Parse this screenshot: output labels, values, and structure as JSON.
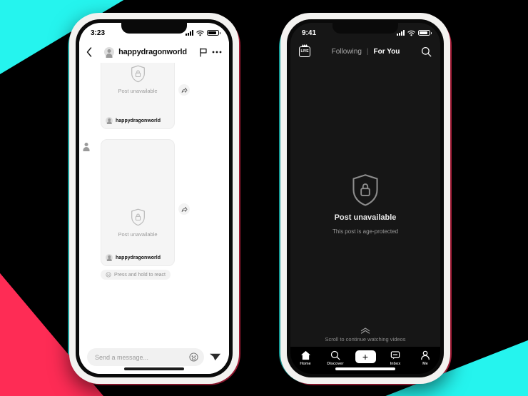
{
  "theme": {
    "cyan": "#25f4ee",
    "pink": "#fe2c55",
    "background": "#000000"
  },
  "left_phone": {
    "status_bar": {
      "time": "3:23",
      "signal_icon": "signal-bars-icon",
      "wifi_icon": "wifi-icon",
      "battery_icon": "battery-icon"
    },
    "header": {
      "back_icon": "chevron-left-icon",
      "avatar": "avatar-icon",
      "title": "happydragonworld",
      "flag_icon": "flag-icon",
      "more_icon": "more-dots-icon"
    },
    "messages": [
      {
        "lock_icon": "shield-lock-icon",
        "status_text": "Post unavailable",
        "author_avatar": "avatar-icon",
        "author": "happydragonworld",
        "share_icon": "share-arrow-icon"
      },
      {
        "lock_icon": "shield-lock-icon",
        "status_text": "Post unavailable",
        "author_avatar": "avatar-icon",
        "author": "happydragonworld",
        "share_icon": "share-arrow-icon"
      }
    ],
    "react_hint": {
      "icon": "emoji-react-icon",
      "text": "Press and hold to react"
    },
    "composer": {
      "placeholder": "Send a message...",
      "emoji_icon": "emoji-face-icon",
      "send_icon": "send-plane-icon"
    }
  },
  "right_phone": {
    "status_bar": {
      "time": "9:41",
      "signal_icon": "signal-bars-icon",
      "wifi_icon": "wifi-icon",
      "battery_icon": "battery-icon"
    },
    "header": {
      "live_label": "LIVE",
      "live_icon": "live-badge-icon",
      "tab_following": "Following",
      "tab_separator": "|",
      "tab_for_you": "For You",
      "search_icon": "search-icon"
    },
    "content": {
      "lock_icon": "shield-lock-icon",
      "title": "Post unavailable",
      "subtitle": "This post is age-protected"
    },
    "scroll_hint": {
      "icon": "chevron-double-up-icon",
      "text": "Scroll to continue watching videos"
    },
    "nav": [
      {
        "icon": "home-icon",
        "label": "Home"
      },
      {
        "icon": "search-icon",
        "label": "Discover"
      },
      {
        "icon": "plus-icon",
        "label": ""
      },
      {
        "icon": "inbox-icon",
        "label": "Inbox"
      },
      {
        "icon": "person-icon",
        "label": "Me"
      }
    ]
  }
}
